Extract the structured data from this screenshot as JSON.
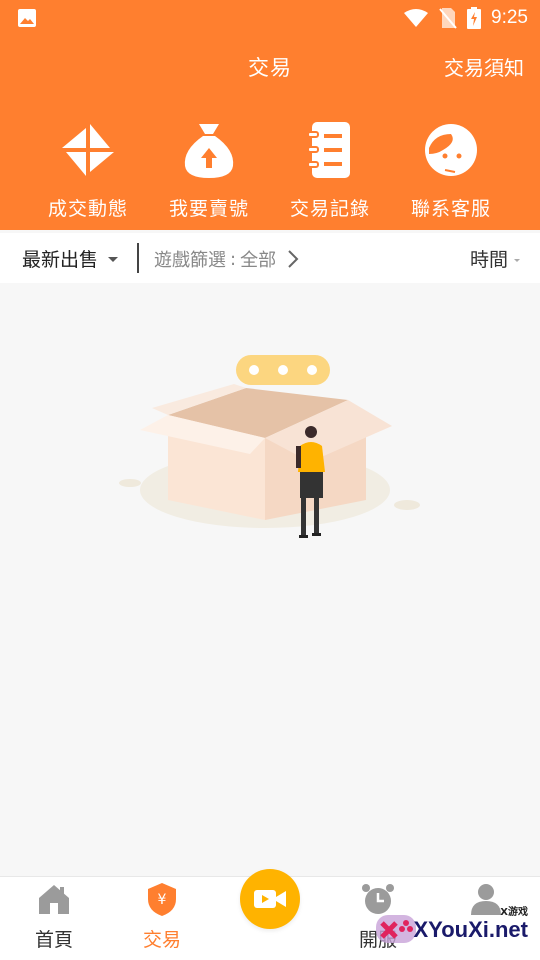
{
  "status_bar": {
    "time": "9:25",
    "icons": [
      "image-icon",
      "wifi-icon",
      "no-sim-icon",
      "battery-charging-icon"
    ]
  },
  "header": {
    "title": "交易",
    "notice_link": "交易須知",
    "quick_actions": [
      {
        "label": "成交動態",
        "icon": "pinwheel-icon"
      },
      {
        "label": "我要賣號",
        "icon": "money-bag-upload-icon"
      },
      {
        "label": "交易記錄",
        "icon": "notebook-icon"
      },
      {
        "label": "聯系客服",
        "icon": "customer-service-icon"
      }
    ]
  },
  "filter_bar": {
    "sort_label": "最新出售",
    "game_filter_label": "遊戲篩選",
    "game_filter_value": "全部",
    "time_label": "時間"
  },
  "empty_state": {
    "illustration": "empty-box-illustration"
  },
  "bottom_nav": {
    "items": [
      {
        "label": "首頁",
        "icon": "home-icon",
        "active": false
      },
      {
        "label": "交易",
        "icon": "yuan-shield-icon",
        "active": true
      },
      {
        "label": "",
        "icon": "video-camera-icon",
        "active": false
      },
      {
        "label": "開服",
        "icon": "alarm-clock-icon",
        "active": false
      },
      {
        "label": "",
        "icon": "user-icon",
        "active": false
      }
    ]
  },
  "watermark": {
    "small_text": "X游戏",
    "big_text": "XYouXi.net"
  },
  "colors": {
    "accent": "#ff7f2f",
    "center_button": "#ffb300",
    "background": "#f7f7f7"
  }
}
